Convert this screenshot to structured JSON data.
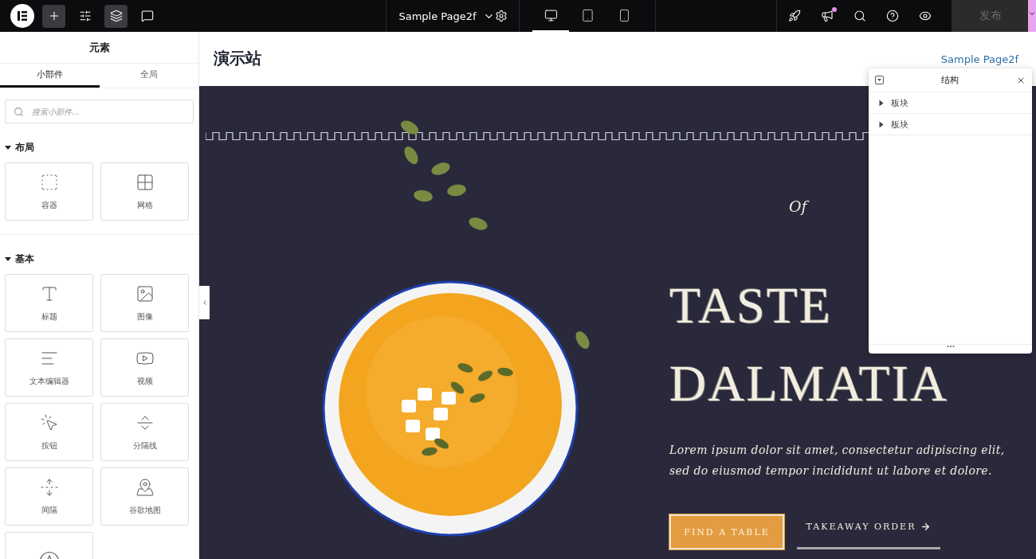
{
  "topbar": {
    "tools": [
      {
        "kind": "logo",
        "active": false
      },
      {
        "kind": "add",
        "active": true
      },
      {
        "kind": "settings",
        "active": false
      },
      {
        "kind": "layers",
        "active": true
      },
      {
        "kind": "comments",
        "active": false
      }
    ],
    "page_title": "Sample Page2f",
    "devices": [
      {
        "kind": "desktop",
        "selected": true
      },
      {
        "kind": "tablet",
        "selected": false
      },
      {
        "kind": "mobile",
        "selected": false
      }
    ],
    "actions": [
      {
        "kind": "rocket",
        "notification": false
      },
      {
        "kind": "megaphone",
        "notification": true
      },
      {
        "kind": "search",
        "notification": false
      },
      {
        "kind": "help",
        "notification": false
      },
      {
        "kind": "preview",
        "notification": false
      }
    ],
    "publish": {
      "label": "发布",
      "disabled": true
    }
  },
  "sidebar": {
    "title": "元素",
    "tabs": [
      {
        "label": "小部件",
        "selected": true
      },
      {
        "label": "全局",
        "selected": false
      }
    ],
    "search": {
      "placeholder": "搜索小部件..."
    },
    "categories": [
      {
        "title": "布局",
        "expanded": true,
        "widgets": [
          {
            "kind": "container",
            "label": "容器"
          },
          {
            "kind": "grid",
            "label": "网格"
          }
        ]
      },
      {
        "title": "基本",
        "expanded": true,
        "widgets": [
          {
            "kind": "heading",
            "label": "标题"
          },
          {
            "kind": "image",
            "label": "图像"
          },
          {
            "kind": "text",
            "label": "文本编辑器"
          },
          {
            "kind": "video",
            "label": "视频"
          },
          {
            "kind": "button",
            "label": "按钮"
          },
          {
            "kind": "divider",
            "label": "分隔线"
          },
          {
            "kind": "spacer",
            "label": "间隔"
          },
          {
            "kind": "map",
            "label": "谷歌地图"
          },
          {
            "kind": "rating"
          }
        ]
      }
    ]
  },
  "canvas": {
    "site_title": "演示站",
    "nav_link": "Sample Page2f",
    "hero": {
      "kicker": "Of",
      "title_lines": [
        "TASTE",
        "DALMATIA"
      ],
      "text": "Lorem ipsum dolor sit amet, consectetur adipiscing elit, sed do eiusmod tempor incididunt ut labore et dolore.",
      "buttons": [
        {
          "kind": "primary",
          "label": "FIND A TABLE"
        },
        {
          "kind": "link",
          "label": "TAKEAWAY ORDER"
        }
      ]
    }
  },
  "structure": {
    "title": "结构",
    "items": [
      {
        "label": "板块",
        "expanded": false
      },
      {
        "label": "板块",
        "expanded": false
      }
    ]
  }
}
